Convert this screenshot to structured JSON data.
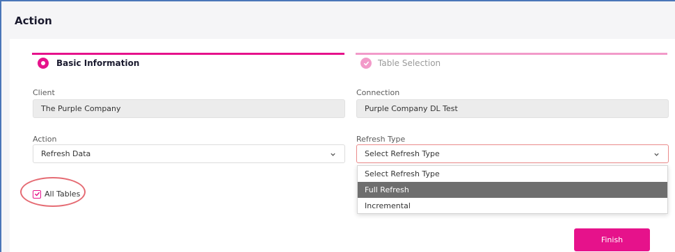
{
  "header": {
    "title": "Action"
  },
  "steps": [
    {
      "label": "Basic Information",
      "state": "active"
    },
    {
      "label": "Table Selection",
      "state": "done"
    }
  ],
  "fields": {
    "client": {
      "label": "Client",
      "value": "The Purple Company"
    },
    "connection": {
      "label": "Connection",
      "value": "Purple Company DL Test"
    },
    "action": {
      "label": "Action",
      "value": "Refresh Data"
    },
    "refresh_type": {
      "label": "Refresh Type",
      "value": "Select Refresh Type"
    }
  },
  "dropdown": {
    "options": [
      "Select Refresh Type",
      "Full Refresh",
      "Incremental"
    ],
    "highlighted": "Full Refresh"
  },
  "all_tables": {
    "label": "All Tables",
    "checked": true
  },
  "buttons": {
    "finish": "Finish"
  },
  "colors": {
    "accent": "#e6128b",
    "accent_light": "#f29ac9",
    "annotation": "#e56b73"
  }
}
